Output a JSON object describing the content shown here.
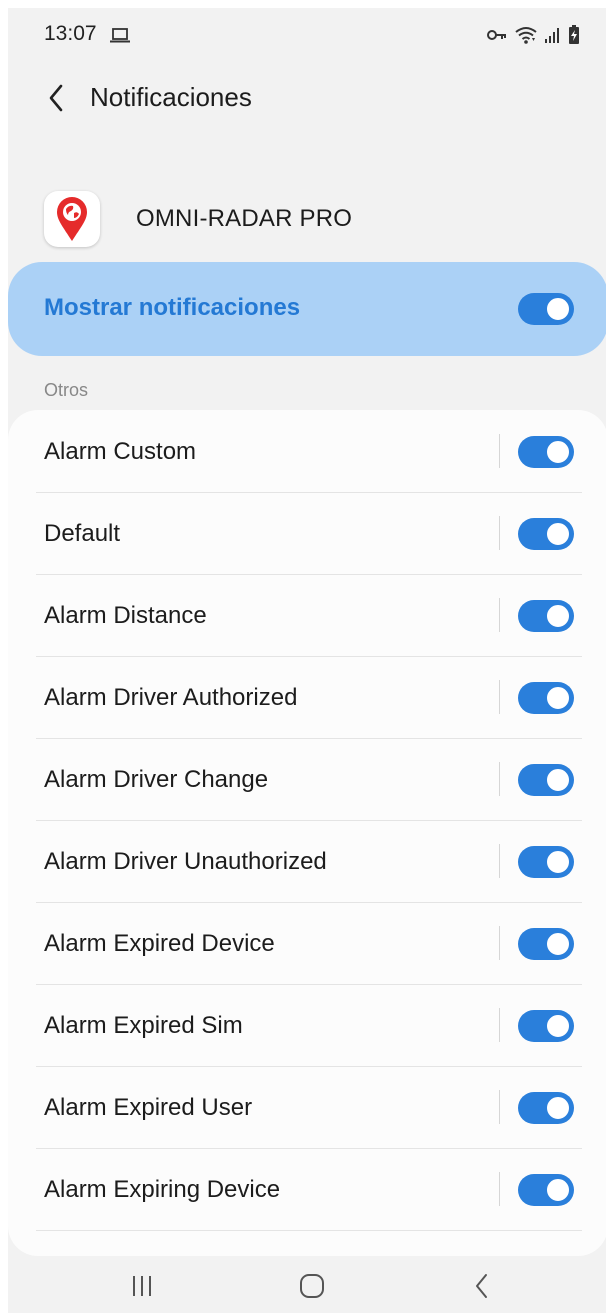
{
  "status_bar": {
    "time": "13:07",
    "icons": [
      "laptop-icon",
      "vpn-key-icon",
      "wifi-icon",
      "signal-icon",
      "battery-charging-icon"
    ]
  },
  "header": {
    "title": "Notificaciones",
    "back_icon": "chevron-left-icon"
  },
  "app": {
    "name": "OMNI-RADAR PRO",
    "icon": "map-pin-globe-icon"
  },
  "master": {
    "label": "Mostrar notificaciones",
    "enabled": true
  },
  "section": {
    "label": "Otros"
  },
  "channels": [
    {
      "label": "Alarm Custom",
      "enabled": true
    },
    {
      "label": "Default",
      "enabled": true
    },
    {
      "label": "Alarm Distance",
      "enabled": true
    },
    {
      "label": "Alarm Driver Authorized",
      "enabled": true
    },
    {
      "label": "Alarm Driver Change",
      "enabled": true
    },
    {
      "label": "Alarm Driver Unauthorized",
      "enabled": true
    },
    {
      "label": "Alarm Expired Device",
      "enabled": true
    },
    {
      "label": "Alarm Expired Sim",
      "enabled": true
    },
    {
      "label": "Alarm Expired User",
      "enabled": true
    },
    {
      "label": "Alarm Expiring Device",
      "enabled": true
    }
  ],
  "nav_bar": {
    "items": [
      "recent-apps-icon",
      "home-icon",
      "back-icon"
    ]
  },
  "colors": {
    "accent": "#2a7fdb",
    "master_bg": "#abd1f6",
    "master_text": "#2479d4",
    "screen_bg": "#f2f2f2",
    "app_pin": "#e52b2b"
  }
}
